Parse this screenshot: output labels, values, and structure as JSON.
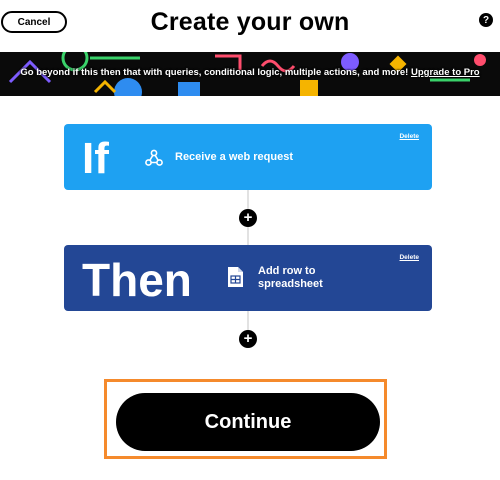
{
  "header": {
    "cancel_label": "Cancel",
    "title": "Create your own",
    "help_icon": "?"
  },
  "banner": {
    "text": "Go beyond if this then that with queries, conditional logic, multiple actions, and more!",
    "link_label": "Upgrade to Pro"
  },
  "trigger": {
    "keyword": "If",
    "service_icon": "webhook-icon",
    "label": "Receive a web request",
    "delete_label": "Delete",
    "color": "#1ea1f2"
  },
  "action": {
    "keyword": "Then",
    "service_icon": "spreadsheet-icon",
    "label": "Add row to spreadsheet",
    "delete_label": "Delete",
    "color": "#234795"
  },
  "add_step_icon": "+",
  "continue_label": "Continue",
  "colors": {
    "highlight": "#f58a2c",
    "banner_bg": "#0a0a0a"
  }
}
